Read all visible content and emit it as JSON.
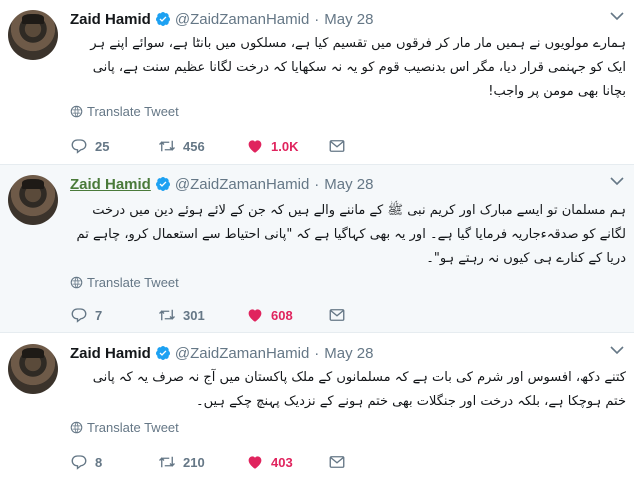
{
  "tweets": [
    {
      "name": "Zaid Hamid",
      "handle": "@ZaidZamanHamid",
      "time": "May 28",
      "text": "ہمارے مولویوں نے ہمیں مار مار کر فرقوں میں تقسیم کیا ہے، مسلکوں میں بانٹا ہے، سوائے اپنے ہر ایک کو جہنمی قرار دیا، مگر اس بدنصیب قوم کو یہ نہ سکھایا کہ درخت لگانا عظیم سنت ہے، پانی بچانا بھی مومن پر واجب!",
      "translate": "Translate Tweet",
      "replies": "25",
      "retweets": "456",
      "likes": "1.0K",
      "liked": true
    },
    {
      "name": "Zaid Hamid",
      "handle": "@ZaidZamanHamid",
      "time": "May 28",
      "text": "ہم مسلمان تو ایسے مبارک اور کریم نبی ﷺ کے ماننے والے ہیں کہ جن کے لائے ہوئے دین میں درخت لگانے کو صدقہءجاریہ فرمایا گیا ہے۔ اور یہ بھی کہاگیا ہے کہ \"پانی احتیاط سے استعمال کرو، چاہے تم دریا کے کنارے ہی کیوں نہ رہتے ہو\"۔",
      "translate": "Translate Tweet",
      "replies": "7",
      "retweets": "301",
      "likes": "608",
      "liked": true
    },
    {
      "name": "Zaid Hamid",
      "handle": "@ZaidZamanHamid",
      "time": "May 28",
      "text": "کتنے دکھ، افسوس اور شرم کی بات ہے کہ مسلمانوں کے ملک پاکستان میں آج نہ صرف یہ کہ پانی ختم ہوچکا ہے، بلکہ درخت اور جنگلات بھی ختم ہونے کے نزدیک پہنچ چکے ہیں۔",
      "translate": "Translate Tweet",
      "replies": "8",
      "retweets": "210",
      "likes": "403",
      "liked": true
    }
  ],
  "colors": {
    "like": "#e0245e",
    "verified": "#1da1f2",
    "muted": "#657786",
    "hover_bg": "#f5f8fa"
  }
}
